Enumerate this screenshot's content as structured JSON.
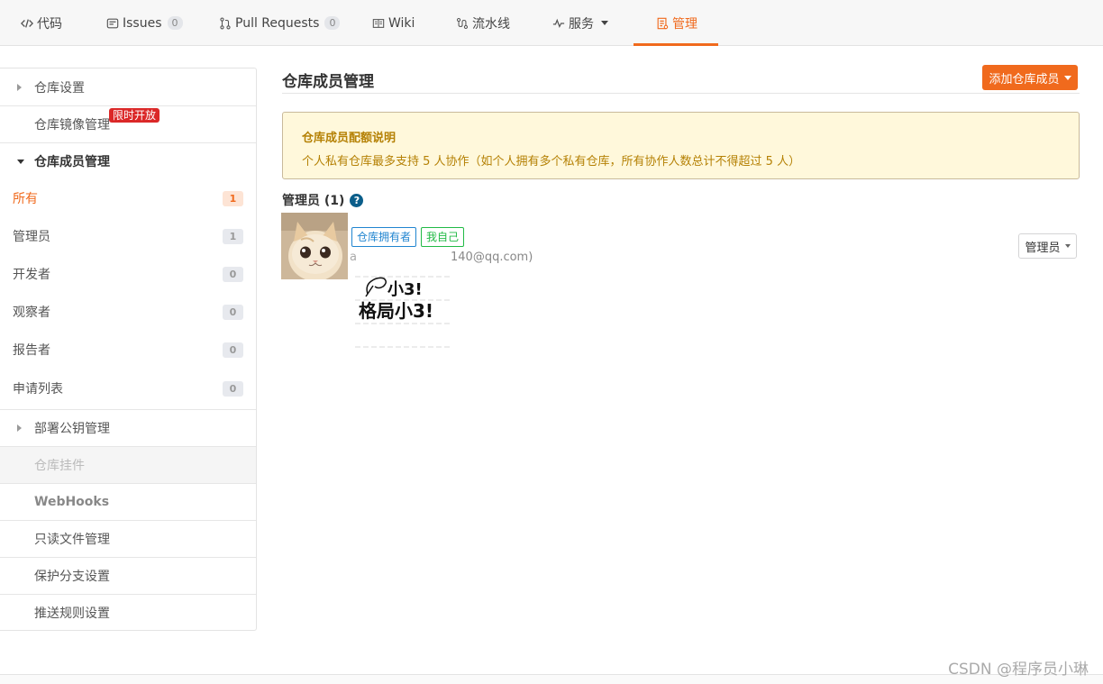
{
  "nav": {
    "tabs": [
      {
        "label": "代码",
        "icon": "code-icon"
      },
      {
        "label": "Issues",
        "count": "0",
        "icon": "issues-icon"
      },
      {
        "label": "Pull Requests",
        "count": "0",
        "icon": "pull-request-icon"
      },
      {
        "label": "Wiki",
        "icon": "book-icon"
      },
      {
        "label": "流水线",
        "icon": "pipeline-icon"
      },
      {
        "label": "服务",
        "icon": "pulse-icon"
      },
      {
        "label": "管理",
        "icon": "settings-doc-icon",
        "active": true
      }
    ],
    "accent_color": "#f06a1d"
  },
  "sidebar": {
    "repo_settings": "仓库设置",
    "mirror": "仓库镜像管理",
    "mirror_badge": "限时开放",
    "members": "仓库成员管理",
    "member_filters": [
      {
        "label": "所有",
        "count": "1"
      },
      {
        "label": "管理员",
        "count": "1"
      },
      {
        "label": "开发者",
        "count": "0"
      },
      {
        "label": "观察者",
        "count": "0"
      },
      {
        "label": "报告者",
        "count": "0"
      },
      {
        "label": "申请列表",
        "count": "0"
      }
    ],
    "deploy_keys": "部署公钥管理",
    "plugins": "仓库挂件",
    "webhooks": "WebHooks",
    "readonly": "只读文件管理",
    "protected_branch": "保护分支设置",
    "push_rules": "推送规则设置"
  },
  "main": {
    "title": "仓库成员管理",
    "add_button": "添加仓库成员",
    "notice_title": "仓库成员配额说明",
    "notice_body": "个人私有仓库最多支持 5 人协作（如个人拥有多个私有仓库，所有协作人数总计不得超过 5 人）",
    "section_title": "管理员 (1)",
    "member": {
      "tag_owner": "仓库拥有者",
      "tag_self": "我自己",
      "email_prefix": "a",
      "email_suffix": "140@qq.com)",
      "role": "管理员",
      "sticker_line1": "小3!",
      "sticker_line2": "格局小3!"
    }
  },
  "watermark": "CSDN @程序员小琳"
}
